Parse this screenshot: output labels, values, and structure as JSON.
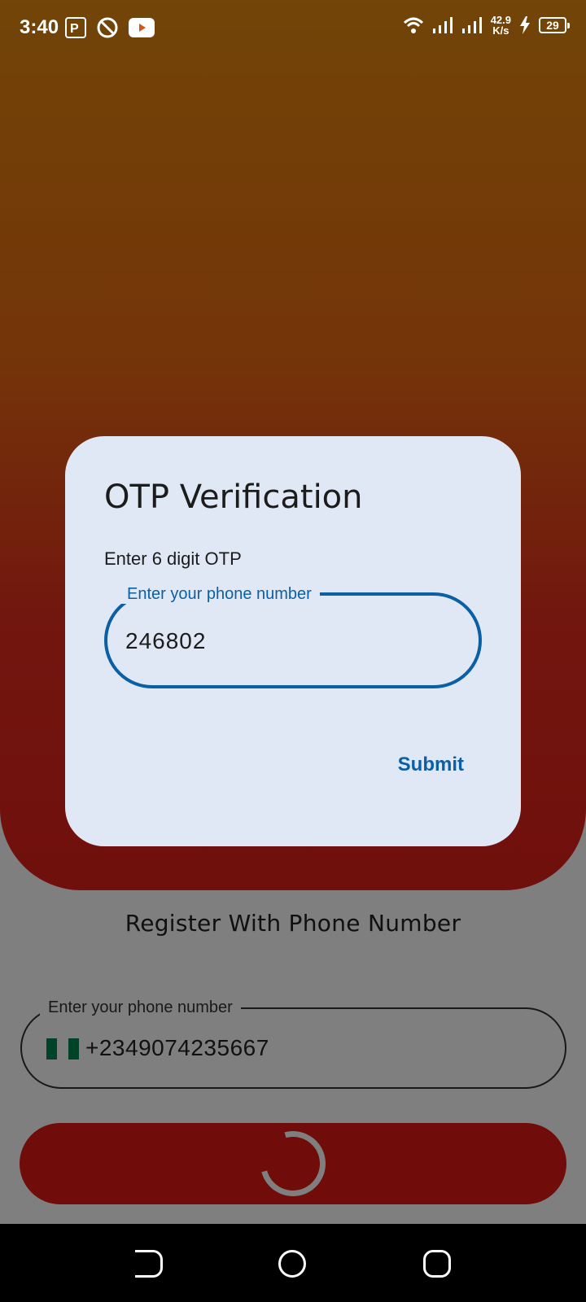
{
  "status_bar": {
    "time": "3:40",
    "net_speed_value": "42.9",
    "net_speed_unit": "K/s",
    "battery": "29"
  },
  "background": {
    "register_title": "Register With Phone Number",
    "phone_label": "Enter your phone number",
    "phone_value": "+2349074235667",
    "flag_colors": [
      "#008751",
      "#ffffff",
      "#008751"
    ]
  },
  "dialog": {
    "title": "OTP Verification",
    "subtitle": "Enter 6 digit OTP",
    "field_label": "Enter your phone number",
    "field_value": "246802",
    "submit_label": "Submit"
  },
  "colors": {
    "accent": "#0b5fa5",
    "button_red": "#e01913"
  }
}
